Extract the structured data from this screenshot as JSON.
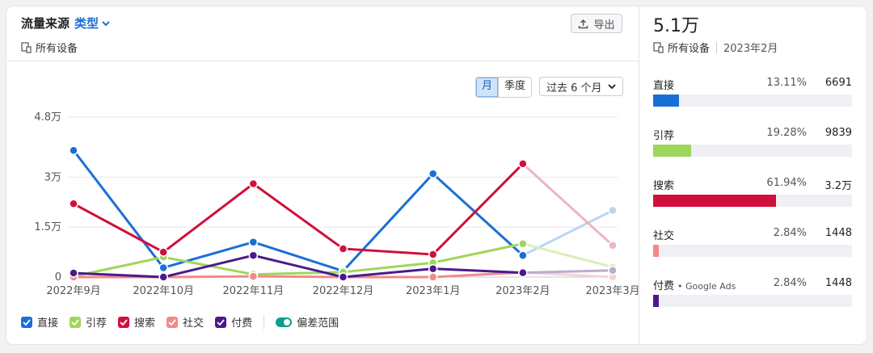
{
  "header": {
    "title": "流量来源",
    "type_label": "类型",
    "devices": "所有设备",
    "export_label": "导出"
  },
  "controls": {
    "month": "月",
    "quarter": "季度",
    "period": "过去 6 个月"
  },
  "legend": {
    "items": [
      {
        "label": "直接",
        "color": "#1a6fd6"
      },
      {
        "label": "引荐",
        "color": "#9fd65a"
      },
      {
        "label": "搜索",
        "color": "#d0103a"
      },
      {
        "label": "社交",
        "color": "#f28a8a"
      },
      {
        "label": "付费",
        "color": "#4b1a8a"
      }
    ],
    "range_label": "偏差范围"
  },
  "summary": {
    "total": "5.1万",
    "devices": "所有设备",
    "date": "2023年2月",
    "rows": [
      {
        "label": "直接",
        "note": "",
        "pct": "13.11%",
        "value": "6691",
        "share": 13.11,
        "color": "#1a6fd6"
      },
      {
        "label": "引荐",
        "note": "",
        "pct": "19.28%",
        "value": "9839",
        "share": 19.28,
        "color": "#9fd65a"
      },
      {
        "label": "搜索",
        "note": "",
        "pct": "61.94%",
        "value": "3.2万",
        "share": 61.94,
        "color": "#d0103a"
      },
      {
        "label": "社交",
        "note": "",
        "pct": "2.84%",
        "value": "1448",
        "share": 2.84,
        "color": "#f28a8a"
      },
      {
        "label": "付费",
        "note": "• Google Ads",
        "pct": "2.84%",
        "value": "1448",
        "share": 2.84,
        "color": "#4b1a8a"
      }
    ]
  },
  "chart_data": {
    "type": "line",
    "categories": [
      "2022年9月",
      "2022年10月",
      "2022年11月",
      "2022年12月",
      "2023年1月",
      "2023年2月",
      "2023年3月"
    ],
    "y_ticks": [
      "0",
      "1.5万",
      "3万",
      "4.8万"
    ],
    "y_tick_values": [
      0,
      15000,
      30000,
      48000
    ],
    "ylim": [
      0,
      48000
    ],
    "grid": true,
    "forecast_from_index": 5,
    "series": [
      {
        "name": "直接",
        "color": "#1a6fd6",
        "forecast_color": "#b9d6f2",
        "values": [
          38000,
          2800,
          10500,
          1800,
          31000,
          6500,
          20000
        ]
      },
      {
        "name": "引荐",
        "color": "#9fd65a",
        "forecast_color": "#d9efbf",
        "values": [
          200,
          6000,
          800,
          1500,
          4300,
          10000,
          3000
        ]
      },
      {
        "name": "搜索",
        "color": "#d0103a",
        "forecast_color": "#f0b3c3",
        "values": [
          22000,
          7500,
          28000,
          8500,
          6800,
          34000,
          9500
        ]
      },
      {
        "name": "社交",
        "color": "#f28a8a",
        "forecast_color": "#f8d2d2",
        "values": [
          0,
          0,
          200,
          0,
          0,
          1400,
          0
        ]
      },
      {
        "name": "付费",
        "color": "#4b1a8a",
        "forecast_color": "#b7adcf",
        "values": [
          1200,
          0,
          6500,
          0,
          2500,
          1300,
          2000
        ]
      }
    ]
  }
}
